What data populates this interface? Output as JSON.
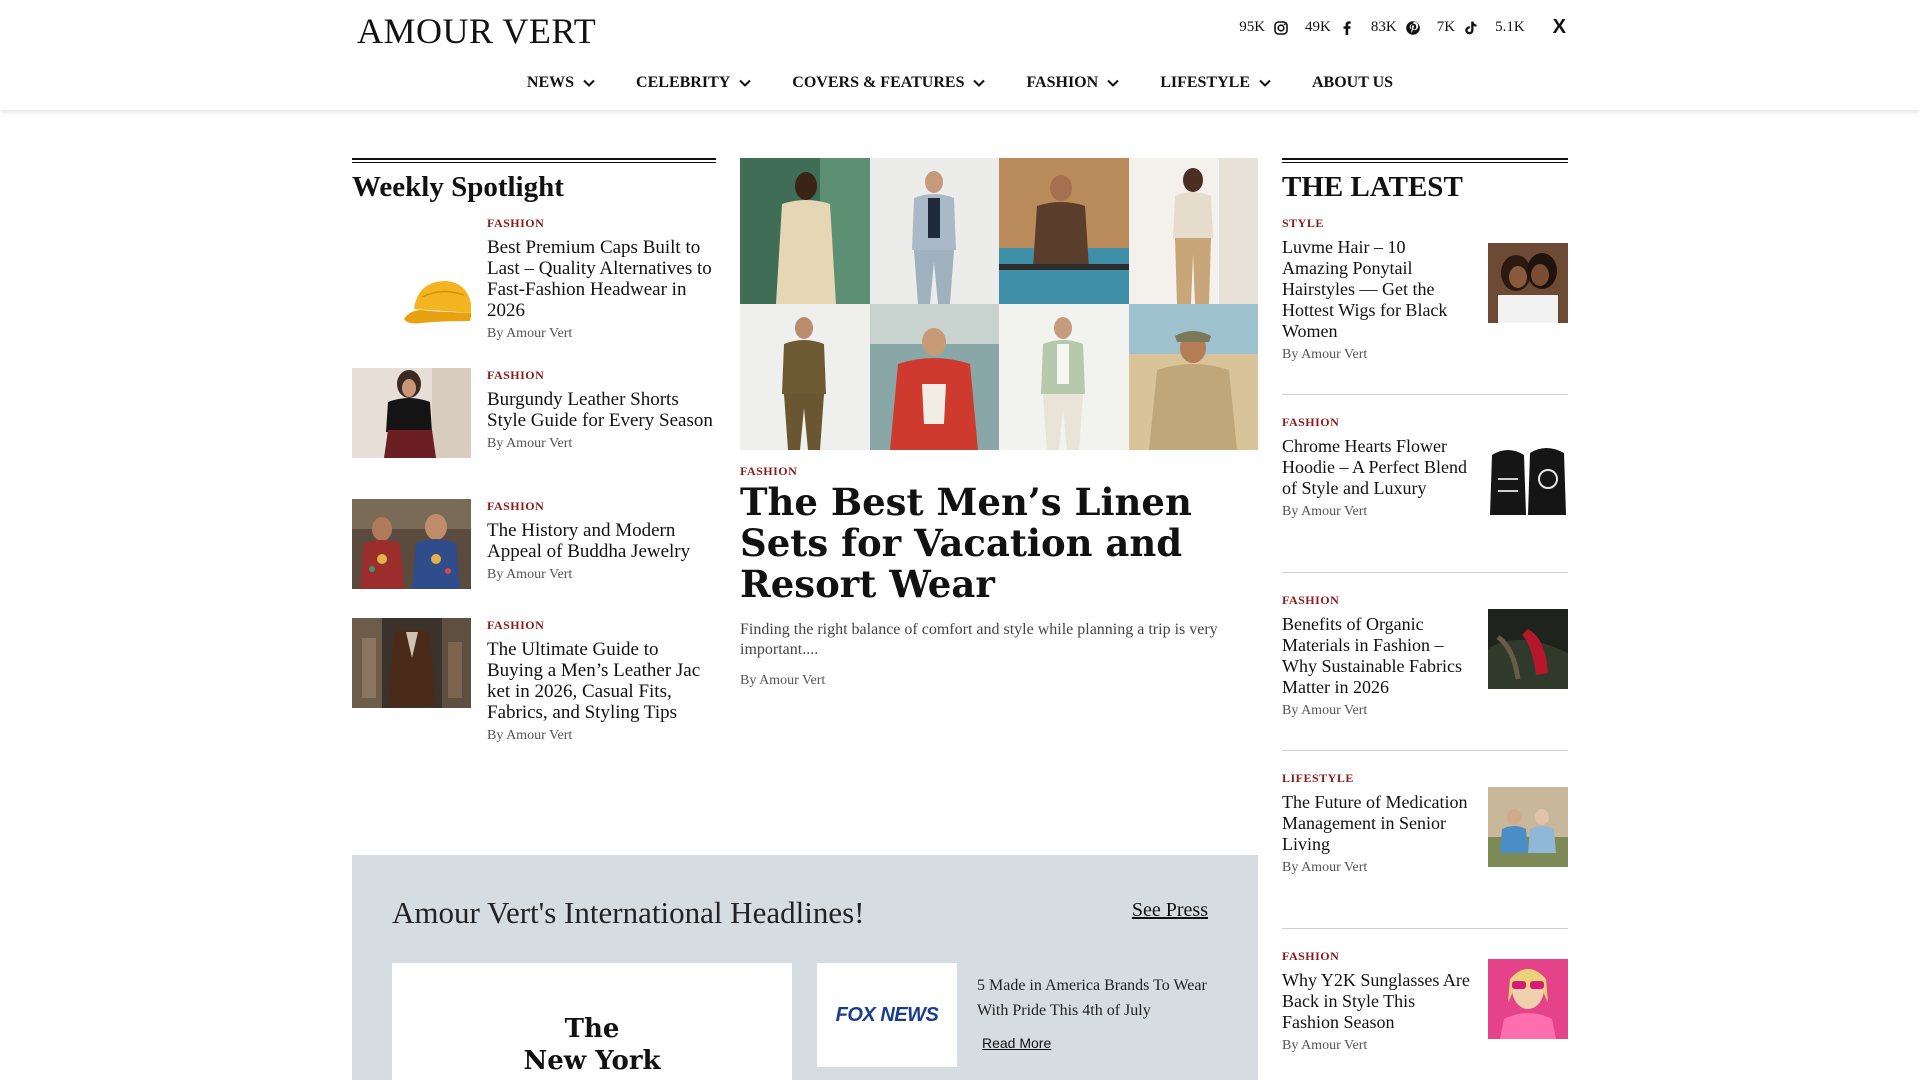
{
  "header": {
    "logo": "AMOUR VERT",
    "social": [
      {
        "count": "95K",
        "icon": "instagram-icon"
      },
      {
        "count": "49K",
        "icon": "facebook-icon"
      },
      {
        "count": "83K",
        "icon": "pinterest-icon"
      },
      {
        "count": "7K",
        "icon": "tiktok-icon"
      },
      {
        "count": "5.1K",
        "icon": "x-icon"
      }
    ],
    "x_glyph": "X"
  },
  "nav": [
    {
      "label": "NEWS"
    },
    {
      "label": "CELEBRITY"
    },
    {
      "label": "COVERS & FEATURES"
    },
    {
      "label": "FASHION"
    },
    {
      "label": "LIFESTYLE"
    },
    {
      "label": "ABOUT US"
    }
  ],
  "spotlight": {
    "title": "Weekly Spotlight",
    "items": [
      {
        "category": "FASHION",
        "title": "Best Premium Caps Built to Last – Quality Alternatives to Fast-Fashion Headwear in 2026",
        "byline": "By Amour Vert"
      },
      {
        "category": "FASHION",
        "title": "Burgundy Leather Shorts Style Guide for Every Season",
        "byline": "By Amour Vert"
      },
      {
        "category": "FASHION",
        "title": "The History and Modern Appeal of Buddha Jewelry",
        "byline": "By Amour Vert"
      },
      {
        "category": "FASHION",
        "title": "The Ultimate Guide to Buying a Men’s Leather Jac ket in 2026, Casual Fits, Fabrics, and Styling Tips",
        "byline": "By Amour Vert"
      }
    ]
  },
  "featured": {
    "category": "FASHION",
    "title": "The Best Men’s Linen Sets for Vacation and Resort Wear",
    "excerpt": "Finding the right balance of comfort and style while planning a trip is very important....",
    "byline": "By Amour Vert"
  },
  "latest": {
    "title": "THE LATEST",
    "items": [
      {
        "category": "STYLE",
        "title": "Luvme Hair – 10 Amazing Ponytail Hairstyles — Get the Hottest Wigs for Black Women",
        "byline": "By Amour Vert"
      },
      {
        "category": "FASHION",
        "title": "Chrome Hearts Flower Hoodie – A Perfect Blend of Style and Luxury",
        "byline": "By Amour Vert"
      },
      {
        "category": "FASHION",
        "title": "Benefits of Organic Materials in Fashion – Why Sustainable Fabrics Matter in 2026",
        "byline": "By Amour Vert"
      },
      {
        "category": "LIFESTYLE",
        "title": "The Future of Medication Management in Senior Living",
        "byline": "By Amour Vert"
      },
      {
        "category": "FASHION",
        "title": "Why Y2K Sunglasses Are Back in Style This Fashion Season",
        "byline": "By Amour Vert"
      }
    ]
  },
  "press": {
    "title": "Amour Vert's International Headlines!",
    "see_press": "See Press",
    "nyt_logo_line1": "The",
    "nyt_logo_line2": "New York",
    "fox_logo": "FOX NEWS",
    "fox_headline": "5 Made in America Brands To Wear With Pride This 4th of July",
    "read_more": "Read More"
  }
}
